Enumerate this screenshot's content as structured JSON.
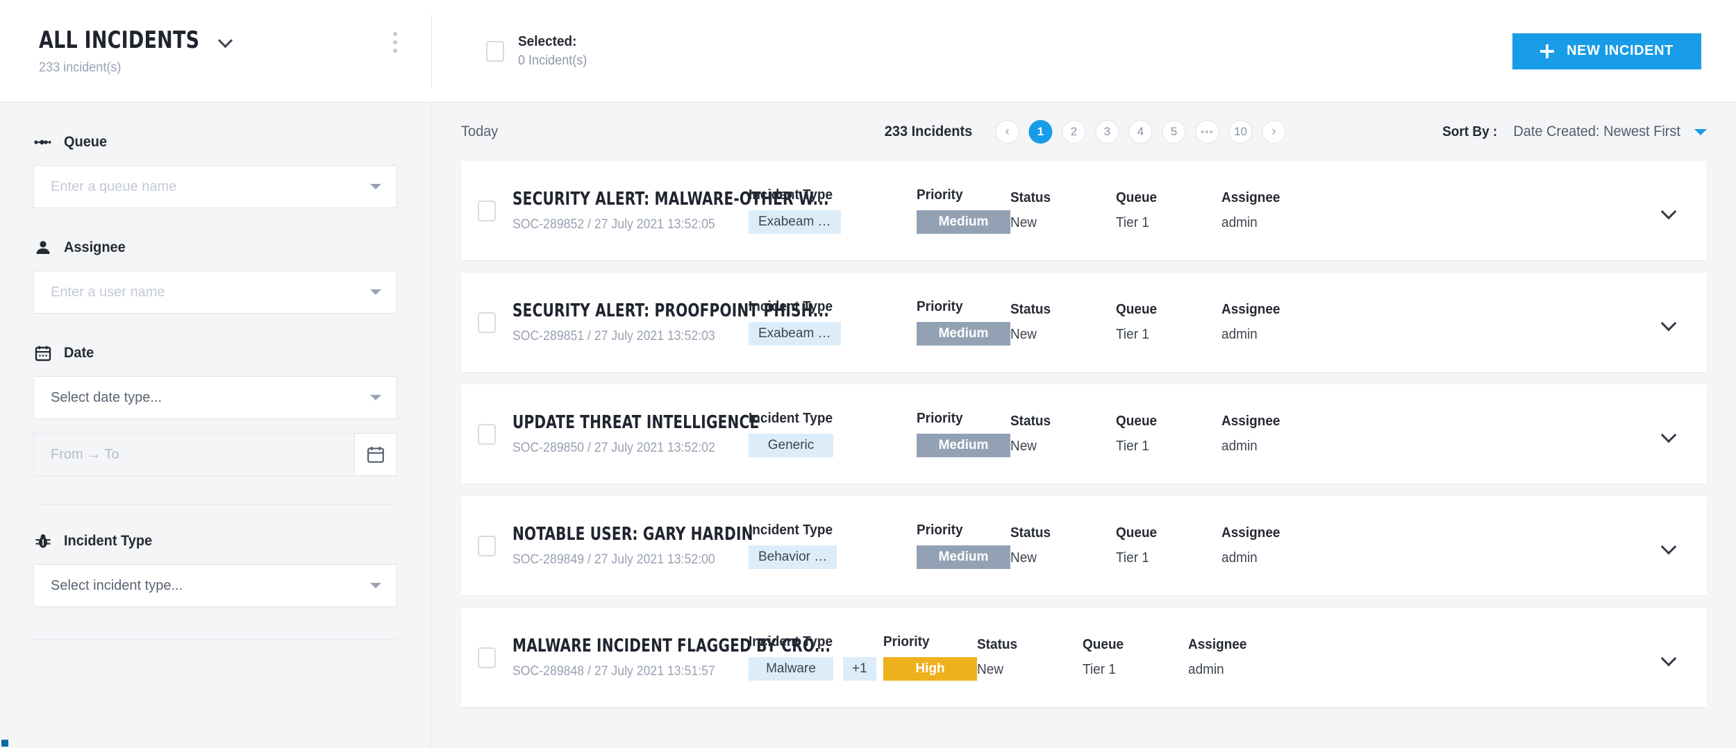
{
  "header": {
    "view_title": "ALL INCIDENTS",
    "view_count": "233 incident(s)",
    "selected_label": "Selected:",
    "selected_value": "0 Incident(s)",
    "new_incident_label": "NEW INCIDENT",
    "accent_color": "#189ce8"
  },
  "sidebar": {
    "filters": [
      {
        "label": "Queue",
        "icon": "queue-icon",
        "placeholder": "Enter a queue name"
      },
      {
        "label": "Assignee",
        "icon": "person-icon",
        "placeholder": "Enter a user name"
      },
      {
        "label": "Date",
        "icon": "calendar-icon",
        "placeholder": "Select date type...",
        "range_placeholder": "From → To"
      },
      {
        "label": "Incident Type",
        "icon": "bug-icon",
        "placeholder": "Select incident type..."
      }
    ]
  },
  "toolbar": {
    "today_label": "Today",
    "count_label": "233 Incidents",
    "pages": [
      "‹",
      "1",
      "2",
      "3",
      "4",
      "5",
      "•••",
      "10",
      "›"
    ],
    "active_page": "1",
    "sort_by_label": "Sort By :",
    "sort_by_value": "Date Created: Newest First"
  },
  "columns": {
    "incident_type": "Incident Type",
    "priority": "Priority",
    "status": "Status",
    "queue": "Queue",
    "assignee": "Assignee"
  },
  "priority_colors": {
    "Medium": "#93a1b4",
    "High": "#efb01e"
  },
  "incidents": [
    {
      "title": "SECURITY ALERT: MALWARE-OTHER W...",
      "subtitle": "SOC-289852 / 27 July 2021 13:52:05",
      "type": "Exabeam …",
      "extra": "",
      "priority": "Medium",
      "status": "New",
      "queue": "Tier 1",
      "assignee": "admin"
    },
    {
      "title": "SECURITY ALERT: PROOFPOINT PHISH...",
      "subtitle": "SOC-289851 / 27 July 2021 13:52:03",
      "type": "Exabeam …",
      "extra": "",
      "priority": "Medium",
      "status": "New",
      "queue": "Tier 1",
      "assignee": "admin"
    },
    {
      "title": "UPDATE THREAT INTELLIGENCE",
      "subtitle": "SOC-289850 / 27 July 2021 13:52:02",
      "type": "Generic",
      "extra": "",
      "priority": "Medium",
      "status": "New",
      "queue": "Tier 1",
      "assignee": "admin"
    },
    {
      "title": "NOTABLE USER: GARY HARDIN",
      "subtitle": "SOC-289849 / 27 July 2021 13:52:00",
      "type": "Behavior …",
      "extra": "",
      "priority": "Medium",
      "status": "New",
      "queue": "Tier 1",
      "assignee": "admin"
    },
    {
      "title": "MALWARE INCIDENT FLAGGED BY CRO...",
      "subtitle": "SOC-289848 / 27 July 2021 13:51:57",
      "type": "Malware",
      "extra": "+1",
      "priority": "High",
      "status": "New",
      "queue": "Tier 1",
      "assignee": "admin"
    }
  ]
}
